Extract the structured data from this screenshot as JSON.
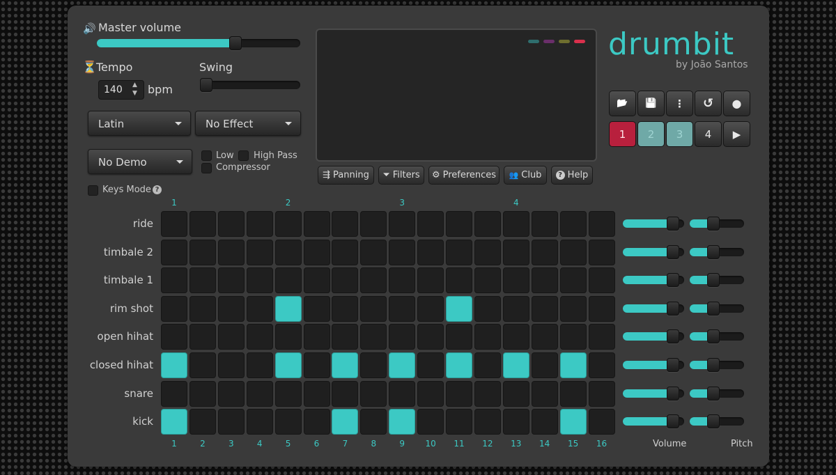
{
  "master": {
    "label": "Master volume",
    "value": 0.68,
    "icon": "speaker-icon"
  },
  "tempo": {
    "label": "Tempo",
    "value": "140",
    "unit": "bpm",
    "icon": "metronome-icon"
  },
  "swing": {
    "label": "Swing",
    "value": 0.0
  },
  "kit_dropdown": {
    "value": "Latin"
  },
  "effect_dropdown": {
    "value": "No Effect"
  },
  "demo_dropdown": {
    "value": "No Demo"
  },
  "filters": {
    "low": "Low",
    "high_pass": "High Pass",
    "compressor": "Compressor"
  },
  "keys_mode": {
    "label": "Keys Mode",
    "icon": "help-circle-icon"
  },
  "leds": [
    "#2f6e6e",
    "#6a2f6a",
    "#6e6e2f",
    "#d9304c"
  ],
  "tabs": [
    {
      "label": "Panning",
      "icon": "sliders-icon",
      "glyph": "⇶"
    },
    {
      "label": "Filters",
      "icon": "funnel-icon",
      "glyph": "⏷"
    },
    {
      "label": "Preferences",
      "icon": "gear-icon",
      "glyph": "⚙"
    },
    {
      "label": "Club",
      "icon": "users-icon",
      "glyph": "👥"
    },
    {
      "label": "Help",
      "icon": "help-icon",
      "glyph": "?"
    }
  ],
  "brand": {
    "name": "drumbit",
    "byline": "by João Santos",
    "accent": "#3cc9c4"
  },
  "toolbar": [
    {
      "name": "open-folder",
      "glyph": "📂"
    },
    {
      "name": "save",
      "glyph": "💾"
    },
    {
      "name": "more",
      "glyph": "⋮"
    },
    {
      "name": "undo",
      "glyph": "↺"
    },
    {
      "name": "record",
      "glyph": "●"
    }
  ],
  "patterns": [
    {
      "label": "1",
      "state": "active",
      "color": "#b8203d"
    },
    {
      "label": "2",
      "state": "filled",
      "color": "#6fa9a7"
    },
    {
      "label": "3",
      "state": "filled",
      "color": "#6fa9a7"
    },
    {
      "label": "4",
      "state": "empty",
      "color": ""
    }
  ],
  "play_glyph": "▶",
  "beat_labels": [
    "1",
    "2",
    "3",
    "4"
  ],
  "step_labels": [
    "1",
    "2",
    "3",
    "4",
    "5",
    "6",
    "7",
    "8",
    "9",
    "10",
    "11",
    "12",
    "13",
    "14",
    "15",
    "16"
  ],
  "rows": [
    {
      "name": "ride",
      "steps": [
        0,
        0,
        0,
        0,
        0,
        0,
        0,
        0,
        0,
        0,
        0,
        0,
        0,
        0,
        0,
        0
      ],
      "volume": 0.92,
      "pitch": 0.44
    },
    {
      "name": "timbale 2",
      "steps": [
        0,
        0,
        0,
        0,
        0,
        0,
        0,
        0,
        0,
        0,
        0,
        0,
        0,
        0,
        0,
        0
      ],
      "volume": 0.92,
      "pitch": 0.44
    },
    {
      "name": "timbale 1",
      "steps": [
        0,
        0,
        0,
        0,
        0,
        0,
        0,
        0,
        0,
        0,
        0,
        0,
        0,
        0,
        0,
        0
      ],
      "volume": 0.92,
      "pitch": 0.44
    },
    {
      "name": "rim shot",
      "steps": [
        0,
        0,
        0,
        0,
        1,
        0,
        0,
        0,
        0,
        0,
        1,
        0,
        0,
        0,
        0,
        0
      ],
      "volume": 0.92,
      "pitch": 0.44
    },
    {
      "name": "open hihat",
      "steps": [
        0,
        0,
        0,
        0,
        0,
        0,
        0,
        0,
        0,
        0,
        0,
        0,
        0,
        0,
        0,
        0
      ],
      "volume": 0.92,
      "pitch": 0.44
    },
    {
      "name": "closed hihat",
      "steps": [
        1,
        0,
        0,
        0,
        1,
        0,
        1,
        0,
        1,
        0,
        1,
        0,
        1,
        0,
        1,
        0
      ],
      "volume": 0.92,
      "pitch": 0.44
    },
    {
      "name": "snare",
      "steps": [
        0,
        0,
        0,
        0,
        0,
        0,
        0,
        0,
        0,
        0,
        0,
        0,
        0,
        0,
        0,
        0
      ],
      "volume": 0.92,
      "pitch": 0.44
    },
    {
      "name": "kick",
      "steps": [
        1,
        0,
        0,
        0,
        0,
        0,
        1,
        0,
        1,
        0,
        0,
        0,
        0,
        0,
        1,
        0
      ],
      "volume": 0.92,
      "pitch": 0.44
    }
  ],
  "footer": {
    "volume": "Volume",
    "pitch": "Pitch"
  }
}
